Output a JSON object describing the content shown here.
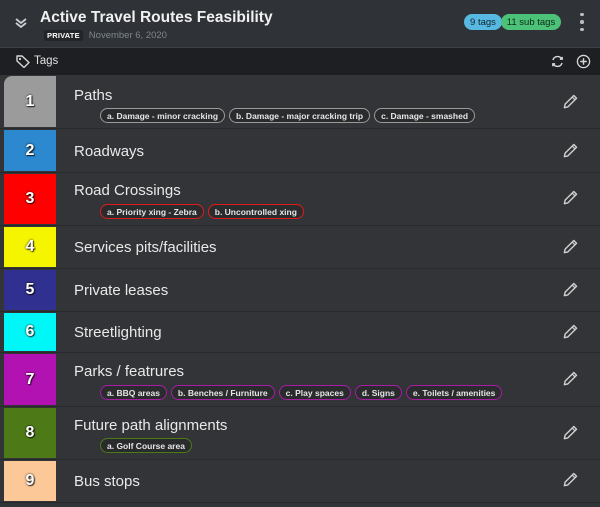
{
  "header": {
    "title": "Active Travel Routes Feasibility",
    "visibility": "PRIVATE",
    "date": "November 6, 2020",
    "tags_count": "9 tags",
    "subtags_count": "11 sub tags"
  },
  "toolbar": {
    "label": "Tags"
  },
  "colors": {
    "tags_pill": "#57b9e2",
    "subtags_pill": "#4cc178"
  },
  "tags": [
    {
      "number": "1",
      "name": "Paths",
      "color": "#9b9b9b",
      "border": "#9a9a9a",
      "subtags": [
        "a. Damage - minor cracking",
        "b. Damage - major cracking trip",
        "c. Damage - smashed"
      ]
    },
    {
      "number": "2",
      "name": "Roadways",
      "color": "#2c89cf",
      "border": "#2c89cf",
      "subtags": []
    },
    {
      "number": "3",
      "name": "Road Crossings",
      "color": "#ff0000",
      "border": "#e01b1b",
      "subtags": [
        "a. Priority xing - Zebra",
        "b. Uncontrolled xing"
      ]
    },
    {
      "number": "4",
      "name": "Services pits/facilities",
      "color": "#f5f500",
      "border": "#e5e500",
      "subtags": []
    },
    {
      "number": "5",
      "name": "Private leases",
      "color": "#303090",
      "border": "#303090",
      "subtags": []
    },
    {
      "number": "6",
      "name": "Streetlighting",
      "color": "#00f7f7",
      "border": "#00e0e0",
      "subtags": []
    },
    {
      "number": "7",
      "name": "Parks / featrures",
      "color": "#b312b3",
      "border": "#a81ca8",
      "subtags": [
        "a. BBQ areas",
        "b. Benches / Furniture",
        "c. Play spaces",
        "d. Signs",
        "e. Toilets / amenities"
      ]
    },
    {
      "number": "8",
      "name": "Future path alignments",
      "color": "#4d7a17",
      "border": "#4d7a17",
      "subtags": [
        "a. Golf Course area"
      ]
    },
    {
      "number": "9",
      "name": "Bus stops",
      "color": "#fdc898",
      "border": "#fdc898",
      "subtags": []
    }
  ]
}
